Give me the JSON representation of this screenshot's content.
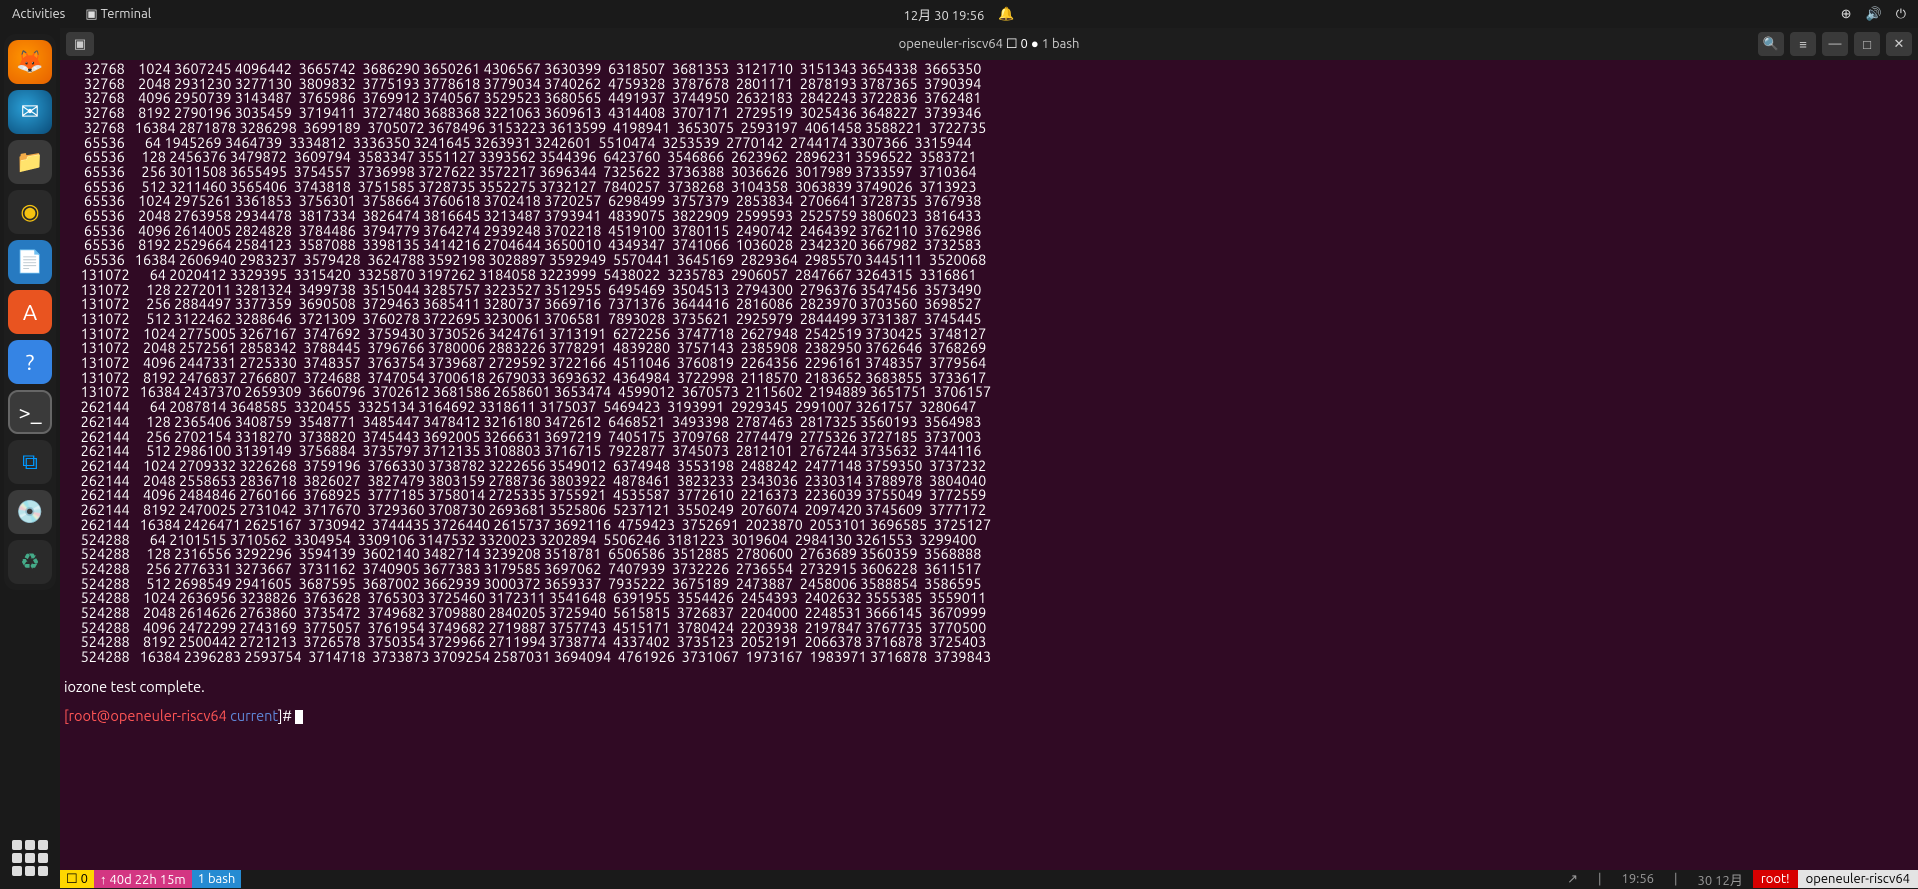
{
  "topbar": {
    "activities": "Activities",
    "terminal": "Terminal",
    "datetime": "12月 30 19:56"
  },
  "window": {
    "title_prefix": "openeuler-riscv64 ",
    "title_sq": "☐ 0 ",
    "title_dot": "● ",
    "title_suffix": "1 bash"
  },
  "terminal": {
    "rows": [
      "      32768    1024 3607245 4096442  3665742  3686290 3650261 4306567 3630399  6318507  3681353  3121710  3151343 3654338  3665350",
      "      32768    2048 2931230 3277130  3809832  3775193 3778618 3779034 3740262  4759328  3787678  2801171  2878193 3787365  3790394",
      "      32768    4096 2950739 3143487  3765986  3769912 3740567 3529523 3680565  4491937  3744950  2632183  2842243 3722836  3762481",
      "      32768    8192 2790196 3035459  3719411  3727480 3688368 3221063 3609613  4314408  3707171  2729519  3025436 3648227  3739346",
      "      32768   16384 2871878 3286298  3699189  3705072 3678496 3153223 3613599  4198941  3653075  2593197  4061458 3588221  3722735",
      "      65536      64 1945269 3464739  3334812  3336350 3241645 3263931 3242601  5510474  3253539  2770142  2744174 3307366  3315944",
      "      65536     128 2456376 3479872  3609794  3583347 3551127 3393562 3544396  6423760  3546866  2623962  2896231 3596522  3583721",
      "      65536     256 3011508 3655495  3754557  3736998 3727622 3572217 3696344  7325622  3736388  3036626  3017989 3733597  3710364",
      "      65536     512 3211460 3565406  3743818  3751585 3728735 3552275 3732127  7840257  3738268  3104358  3063839 3749026  3713923",
      "      65536    1024 2975261 3361853  3756301  3758664 3760618 3702418 3720257  6298499  3757379  2853834  2706641 3728735  3767938",
      "      65536    2048 2763958 2934478  3817334  3826474 3816645 3213487 3793941  4839075  3822909  2599593  2525759 3806023  3816433",
      "      65536    4096 2614005 2824828  3784486  3794779 3764274 2939248 3702218  4519100  3780115  2490742  2464392 3762110  3762986",
      "      65536    8192 2529664 2584123  3587088  3398135 3414216 2704644 3650010  4349347  3741066  1036028  2342320 3667982  3732583",
      "      65536   16384 2606940 2983237  3579428  3624788 3592198 3028897 3592949  5570441  3645169  2829364  2985570 3445111  3520068",
      "     131072      64 2020412 3329395  3315420  3325870 3197262 3184058 3223999  5438022  3235783  2906057  2847667 3264315  3316861",
      "     131072     128 2272011 3281324  3499738  3515044 3285757 3223527 3512955  6495469  3504513  2794300  2796376 3547456  3573490",
      "     131072     256 2884497 3377359  3690508  3729463 3685411 3280737 3669716  7371376  3644416  2816086  2823970 3703560  3698527",
      "     131072     512 3122462 3288646  3721309  3760278 3722695 3230061 3706581  7893028  3735621  2925979  2844499 3731387  3745445",
      "     131072    1024 2775005 3267167  3747692  3759430 3730526 3424761 3713191  6272256  3747718  2627948  2542519 3730425  3748127",
      "     131072    2048 2572561 2858342  3788445  3796766 3780006 2883226 3778291  4839280  3757143  2385908  2382950 3762646  3768269",
      "     131072    4096 2447331 2725330  3748357  3763754 3739687 2729592 3722166  4511046  3760819  2264356  2296161 3748357  3779564",
      "     131072    8192 2476837 2766807  3724688  3747054 3700618 2679033 3693632  4364984  3722998  2118570  2183652 3683855  3733617",
      "     131072   16384 2437370 2659309  3660796  3702612 3681586 2658601 3653474  4599012  3670573  2115602  2194889 3651751  3706157",
      "     262144      64 2087814 3648585  3320455  3325134 3164692 3318611 3175037  5469423  3193991  2929345  2991007 3261757  3280647",
      "     262144     128 2365406 3408759  3548771  3485447 3478412 3216180 3472612  6468521  3493398  2787463  2817325 3560193  3564983",
      "     262144     256 2702154 3318270  3738820  3745443 3692005 3266631 3697219  7405175  3709768  2774479  2775326 3727185  3737003",
      "     262144     512 2986100 3139149  3756884  3735797 3712135 3108803 3716715  7922877  3745073  2812101  2767244 3735632  3744116",
      "     262144    1024 2709332 3226268  3759196  3766330 3738782 3222656 3549012  6374948  3553198  2488242  2477148 3759350  3737232",
      "     262144    2048 2558653 2836718  3826027  3827479 3803159 2788736 3803922  4878461  3823233  2343036  2330314 3788978  3804040",
      "     262144    4096 2484846 2760166  3768925  3777185 3758014 2725335 3755921  4535587  3772610  2216373  2236039 3755049  3772559",
      "     262144    8192 2470025 2731042  3717670  3729360 3708730 2693681 3525806  5237121  3550249  2076074  2097420 3745609  3777172",
      "     262144   16384 2426471 2625167  3730942  3744435 3726440 2615737 3692116  4759423  3752691  2023870  2053101 3696585  3725127",
      "     524288      64 2101515 3710562  3304954  3309106 3147532 3320023 3202894  5506246  3181223  3019604  2984130 3261553  3299400",
      "     524288     128 2316556 3292296  3594139  3602140 3482714 3239208 3518781  6506586  3512885  2780600  2763689 3560359  3568888",
      "     524288     256 2776331 3273667  3731162  3740905 3677383 3179585 3697062  7407939  3732226  2736554  2732915 3606228  3611517",
      "     524288     512 2698549 2941605  3687595  3687002 3662939 3000372 3659337  7935222  3675189  2473887  2458006 3588854  3586595",
      "     524288    1024 2636956 3238826  3763628  3765303 3725460 3172311 3541648  6391955  3554426  2454393  2402632 3555385  3559011",
      "     524288    2048 2614626 2763860  3735472  3749682 3709880 2840205 3725940  5615815  3726837  2204000  2248531 3666145  3670999",
      "     524288    4096 2472299 2743169  3775057  3761954 3749682 2719887 3757743  4515171  3780424  2203938  2197847 3767735  3770500",
      "     524288    8192 2500442 2721213  3726578  3750354 3729966 2711994 3738774  4337402  3735123  2052191  2066378 3716878  3725403",
      "     524288   16384 2396283 2593754  3714718  3733873 3709254 2587031 3694094  4761926  3731067  1973167  1983971 3716878  3739843",
      "",
      "iozone test complete.",
      ""
    ],
    "prompt_user_host": "[root@openeuler-riscv64 ",
    "prompt_path": "current",
    "prompt_suffix": "]# "
  },
  "statusbar": {
    "seg_yellow": "☐ 0",
    "seg_pink": "↑ 40d 22h 15m",
    "seg_blue": "1 bash",
    "right_arrow": "↗",
    "right_time": "19:56",
    "right_sep": "|",
    "right_date": "30 12月",
    "right_root": "root!",
    "right_host": "openeuler-riscv64"
  }
}
